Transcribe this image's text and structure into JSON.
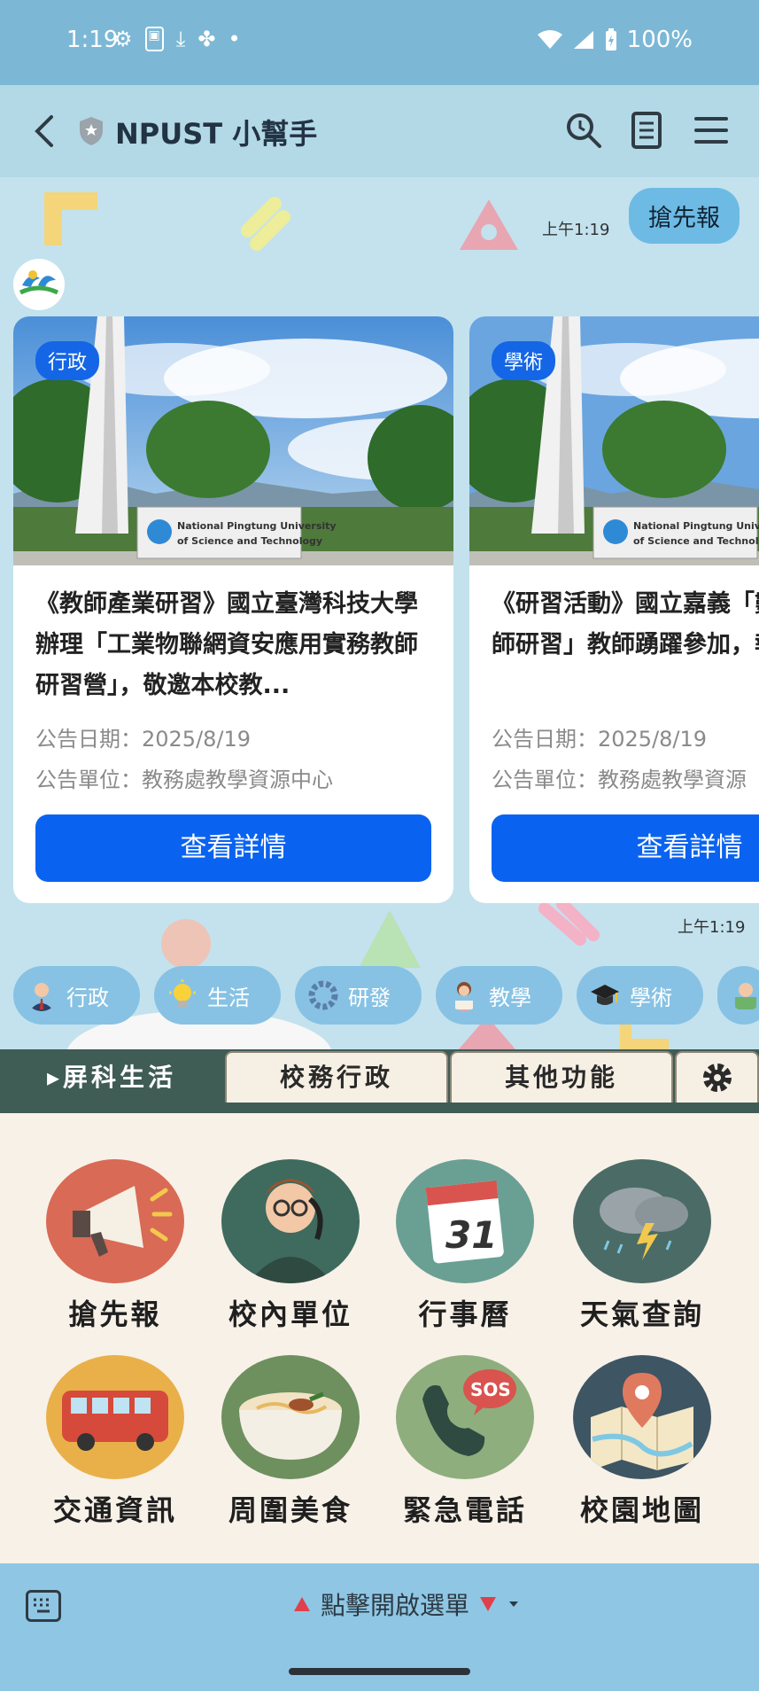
{
  "status_bar": {
    "time": "1:19",
    "battery": "100%"
  },
  "header": {
    "title": "NPUST 小幫手"
  },
  "chat": {
    "sent_message": "搶先報",
    "sent_time": "上午1:19",
    "received_time": "上午1:19",
    "cards": [
      {
        "tag": "行政",
        "title": "《教師產業研習》國立臺灣科技大學辦理「工業物聯網資安應用實務教師研習營」，敬邀本校教...",
        "date": "公告日期：2025/8/19",
        "unit": "公告單位：教務處教學資源中心",
        "button": "查看詳情"
      },
      {
        "tag": "學術",
        "title": "《研習活動》國立嘉義「數位課程教師研習」教師踴躍參加，報名至",
        "date": "公告日期：2025/8/19",
        "unit": "公告單位：教務處教學資源",
        "button": "查看詳情"
      }
    ],
    "quick_replies": [
      {
        "label": "行政",
        "icon": "person-icon"
      },
      {
        "label": "生活",
        "icon": "bulb-icon"
      },
      {
        "label": "研發",
        "icon": "gear-icon"
      },
      {
        "label": "教學",
        "icon": "teacher-icon"
      },
      {
        "label": "學術",
        "icon": "graduation-cap-icon"
      }
    ]
  },
  "rich_menu": {
    "tabs": [
      "屏科生活",
      "校務行政",
      "其他功能"
    ],
    "active_tab": "屏科生活",
    "items": [
      {
        "label": "搶先報",
        "icon": "megaphone-icon"
      },
      {
        "label": "校內單位",
        "icon": "phone-person-icon"
      },
      {
        "label": "行事曆",
        "icon": "calendar-icon",
        "number": "31"
      },
      {
        "label": "天氣查詢",
        "icon": "storm-cloud-icon"
      },
      {
        "label": "交通資訊",
        "icon": "bus-icon"
      },
      {
        "label": "周圍美食",
        "icon": "noodle-bowl-icon"
      },
      {
        "label": "緊急電話",
        "icon": "sos-phone-icon",
        "badge": "SOS"
      },
      {
        "label": "校園地圖",
        "icon": "map-pin-icon"
      }
    ]
  },
  "bottom_bar": {
    "open_menu_label": "點擊開啟選單"
  },
  "colors": {
    "accent": "#0a63f0",
    "menu_tab_bg": "#3f5c55",
    "chat_bg": "#c3e2ee"
  }
}
